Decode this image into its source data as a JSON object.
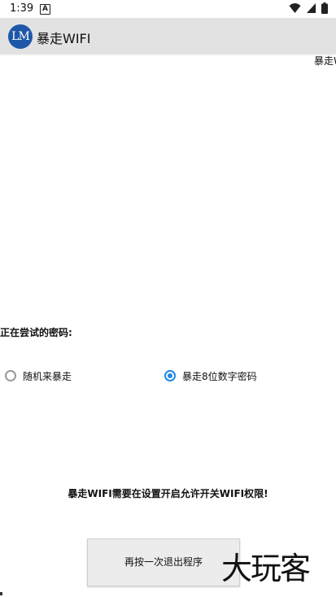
{
  "status_bar": {
    "time": "1:39",
    "notification_icon": "a-letter-icon",
    "icons": [
      "wifi-icon",
      "cellular-signal-icon",
      "battery-icon"
    ]
  },
  "app_bar": {
    "logo_text": "LM",
    "title": "暴走WIFI",
    "background": "#e2e2e2",
    "logo_color": "#1f57a8"
  },
  "marquee": {
    "text": "暴走W"
  },
  "trying": {
    "label": "正在尝试的密码:",
    "value": ""
  },
  "modes": {
    "options": [
      {
        "label": "随机来暴走",
        "checked": false
      },
      {
        "label": "暴走8位数字密码",
        "checked": true
      }
    ],
    "accent": "#1e88e5"
  },
  "permission_note": "暴走WIFI需要在设置开启允许开关WIFI权限!",
  "exit_button": {
    "label": "再按一次退出程序"
  },
  "watermark": {
    "text": "大玩客"
  }
}
